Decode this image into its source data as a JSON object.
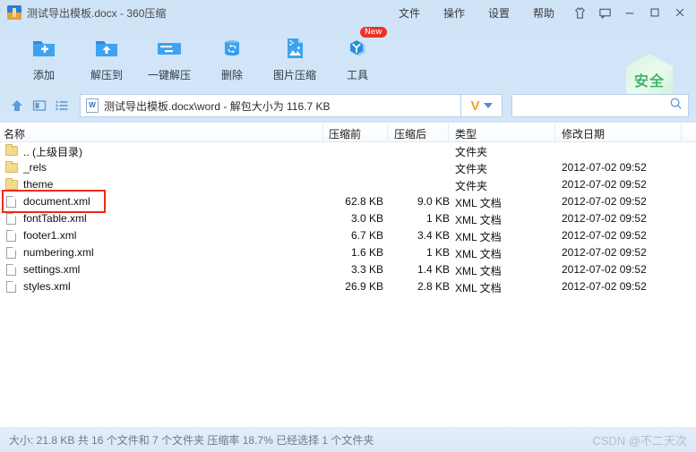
{
  "window": {
    "title": "测试导出模板.docx - 360压缩",
    "app_icon": "archive-app-icon",
    "menus": [
      {
        "label": "文件",
        "name": "menu-file"
      },
      {
        "label": "操作",
        "name": "menu-action"
      },
      {
        "label": "设置",
        "name": "menu-settings"
      },
      {
        "label": "帮助",
        "name": "menu-help"
      }
    ],
    "controls": [
      {
        "name": "skin-icon",
        "title": "皮肤"
      },
      {
        "name": "feedback-icon",
        "title": "反馈"
      },
      {
        "name": "minimize-button",
        "title": "最小化"
      },
      {
        "name": "maximize-button",
        "title": "最大化"
      },
      {
        "name": "close-button",
        "title": "关闭"
      }
    ]
  },
  "toolbar": {
    "buttons": [
      {
        "label": "添加",
        "icon": "folder-add-icon",
        "badge": ""
      },
      {
        "label": "解压到",
        "icon": "folder-extract-icon",
        "badge": ""
      },
      {
        "label": "一键解压",
        "icon": "one-click-extract-icon",
        "badge": ""
      },
      {
        "label": "删除",
        "icon": "recycle-bin-icon",
        "badge": ""
      },
      {
        "label": "图片压缩",
        "icon": "image-compress-icon",
        "badge": ""
      },
      {
        "label": "工具",
        "icon": "tools-icon",
        "badge": "New"
      }
    ],
    "safe_badge": {
      "label": "安全",
      "icon": "shield-hexagon-icon",
      "color": "#3fb46b"
    }
  },
  "address": {
    "up_icon": "up-arrow-icon",
    "preview_icon": "preview-pane-icon",
    "list_icon": "list-view-icon",
    "file_icon": "word-document-icon",
    "path": "测试导出模板.docx\\word - 解包大小为 116.7 KB",
    "dropdown": {
      "mark": "V",
      "icon": "chevron-down-icon"
    },
    "search": {
      "value": "",
      "placeholder": "",
      "icon": "search-icon"
    }
  },
  "list": {
    "columns": [
      {
        "label": "名称",
        "name": "column-name"
      },
      {
        "label": "压缩前",
        "name": "column-size-before"
      },
      {
        "label": "压缩后",
        "name": "column-size-after"
      },
      {
        "label": "类型",
        "name": "column-type"
      },
      {
        "label": "修改日期",
        "name": "column-modified"
      }
    ],
    "rows": [
      {
        "name": ".. (上级目录)",
        "icon": "folder-icon",
        "before": "",
        "after": "",
        "type": "文件夹",
        "date": "",
        "highlight": false
      },
      {
        "name": "_rels",
        "icon": "folder-icon",
        "before": "",
        "after": "",
        "type": "文件夹",
        "date": "2012-07-02 09:52",
        "highlight": false
      },
      {
        "name": "theme",
        "icon": "folder-icon",
        "before": "",
        "after": "",
        "type": "文件夹",
        "date": "2012-07-02 09:52",
        "highlight": false
      },
      {
        "name": "document.xml",
        "icon": "xml-file-icon",
        "before": "62.8 KB",
        "after": "9.0 KB",
        "type": "XML 文档",
        "date": "2012-07-02 09:52",
        "highlight": true
      },
      {
        "name": "fontTable.xml",
        "icon": "xml-file-icon",
        "before": "3.0 KB",
        "after": "1 KB",
        "type": "XML 文档",
        "date": "2012-07-02 09:52",
        "highlight": false
      },
      {
        "name": "footer1.xml",
        "icon": "xml-file-icon",
        "before": "6.7 KB",
        "after": "3.4 KB",
        "type": "XML 文档",
        "date": "2012-07-02 09:52",
        "highlight": false
      },
      {
        "name": "numbering.xml",
        "icon": "xml-file-icon",
        "before": "1.6 KB",
        "after": "1 KB",
        "type": "XML 文档",
        "date": "2012-07-02 09:52",
        "highlight": false
      },
      {
        "name": "settings.xml",
        "icon": "xml-file-icon",
        "before": "3.3 KB",
        "after": "1.4 KB",
        "type": "XML 文档",
        "date": "2012-07-02 09:52",
        "highlight": false
      },
      {
        "name": "styles.xml",
        "icon": "xml-file-icon",
        "before": "26.9 KB",
        "after": "2.8 KB",
        "type": "XML 文档",
        "date": "2012-07-02 09:52",
        "highlight": false
      }
    ]
  },
  "status": {
    "text": "大小: 21.8 KB 共 16 个文件和 7 个文件夹 压缩率 18.7% 已经选择 1 个文件夹"
  },
  "watermark": {
    "text": "CSDN @不二天次"
  }
}
